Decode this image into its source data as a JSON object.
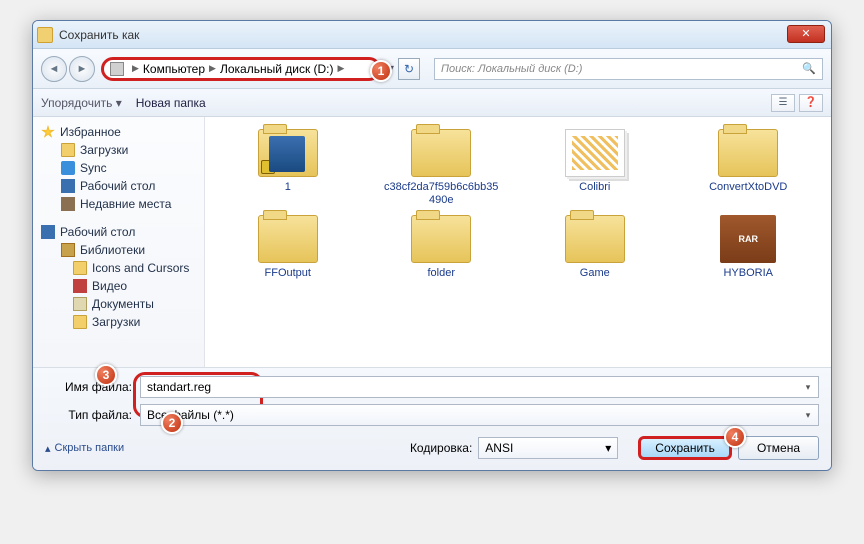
{
  "titlebar": {
    "title": "Сохранить как",
    "close": "✕"
  },
  "nav": {
    "back": "◄",
    "fwd": "►",
    "crumbs": {
      "computer": "Компьютер",
      "disk": "Локальный диск (D:)"
    },
    "refresh": "↻",
    "search_placeholder": "Поиск: Локальный диск (D:)"
  },
  "toolbar": {
    "organize": "Упорядочить ▾",
    "newfolder": "Новая папка",
    "v1": "☰",
    "v2": "❓"
  },
  "callouts": {
    "c1": "1",
    "c2": "2",
    "c3": "3",
    "c4": "4"
  },
  "sidebar": {
    "fav": "Избранное",
    "downloads": "Загрузки",
    "sync": "Sync",
    "desktop": "Рабочий стол",
    "recent": "Недавние места",
    "desktop2": "Рабочий стол",
    "libs": "Библиотеки",
    "icons": "Icons and Cursors",
    "video": "Видео",
    "docs": "Документы",
    "dl2": "Загрузки"
  },
  "items": [
    {
      "name": "1"
    },
    {
      "name": "c38cf2da7f59b6c6bb35490e"
    },
    {
      "name": "Colibri"
    },
    {
      "name": "ConvertXtoDVD"
    },
    {
      "name": "FFOutput"
    },
    {
      "name": "folder"
    },
    {
      "name": "Game"
    },
    {
      "name": "HYBORIA"
    }
  ],
  "bottom": {
    "fn_label": "Имя файла:",
    "fn_value": "standart.reg",
    "ft_label": "Тип файла:",
    "ft_value": "Все файлы (*.*)",
    "hide": "Скрыть папки",
    "enc_label": "Кодировка:",
    "enc_value": "ANSI",
    "save": "Сохранить",
    "cancel": "Отмена"
  }
}
